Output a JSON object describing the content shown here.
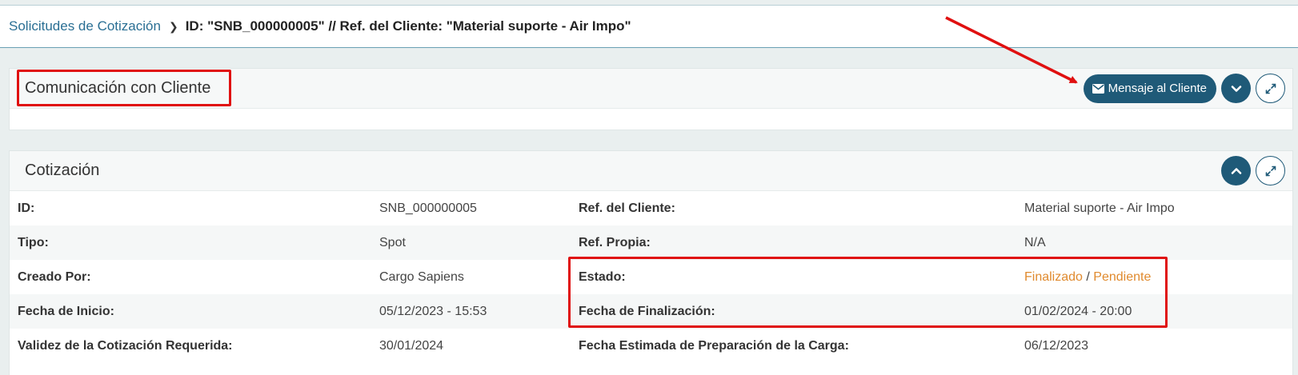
{
  "breadcrumb": {
    "parent": "Solicitudes de Cotización",
    "current": "ID: \"SNB_000000005\" // Ref. del Cliente: \"Material suporte - Air Impo\""
  },
  "communication": {
    "title": "Comunicación con Cliente",
    "message_button": "Mensaje al Cliente"
  },
  "quotation": {
    "title": "Cotización",
    "rows": [
      {
        "left_label": "ID:",
        "left_value": "SNB_000000005",
        "right_label": "Ref. del Cliente:",
        "right_value": "Material suporte - Air Impo"
      },
      {
        "left_label": "Tipo:",
        "left_value": "Spot",
        "right_label": "Ref. Propia:",
        "right_value": "N/A"
      },
      {
        "left_label": "Creado Por:",
        "left_value": "Cargo Sapiens",
        "right_label": "Estado:",
        "right_value": ""
      },
      {
        "left_label": "Fecha de Inicio:",
        "left_value": "05/12/2023 - 15:53",
        "right_label": "Fecha de Finalización:",
        "right_value": "01/02/2024 - 20:00"
      },
      {
        "left_label": "Validez de la Cotización Requerida:",
        "left_value": "30/01/2024",
        "right_label": "Fecha Estimada de Preparación de la Carga:",
        "right_value": "06/12/2023"
      }
    ],
    "status": {
      "first": "Finalizado",
      "separator": "/",
      "second": "Pendiente"
    }
  },
  "colors": {
    "accent": "#1f5a78",
    "link": "#2a6f94",
    "status": "#e08a2e",
    "annotation": "#e01010"
  },
  "icons": [
    "chevron-right-icon",
    "envelope-icon",
    "chevron-down-icon",
    "expand-icon",
    "chevron-up-icon"
  ]
}
